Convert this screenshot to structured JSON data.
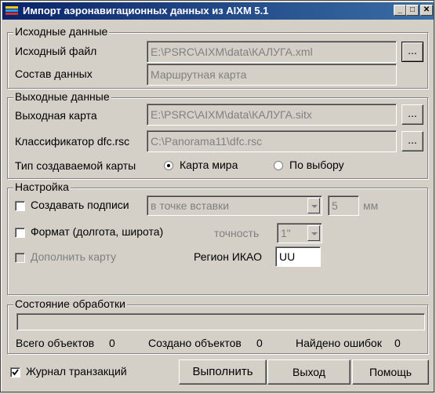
{
  "window": {
    "title": "Импорт аэронавигационных данных из AIXM 5.1"
  },
  "source": {
    "group_label": "Исходные данные",
    "file_label": "Исходный файл",
    "file_value": "E:\\PSRC\\AIXM\\data\\КАЛУГА.xml",
    "browse_label": "...",
    "composition_label": "Состав данных",
    "composition_value": "Маршрутная карта"
  },
  "output": {
    "group_label": "Выходные данные",
    "map_label": "Выходная карта",
    "map_value": "E:\\PSRC\\AIXM\\data\\КАЛУГА.sitx",
    "classifier_label": "Классификатор dfc.rsc",
    "classifier_value": "C:\\Panorama11\\dfc.rsc",
    "browse_label": "...",
    "map_type_label": "Тип создаваемой карты",
    "radio_world": "Карта мира",
    "radio_choice": "По выбору"
  },
  "settings": {
    "group_label": "Настройка",
    "create_labels": "Создавать подписи",
    "labels_position": "в точке вставки",
    "labels_size": "5",
    "labels_unit": "мм",
    "format_label": "Формат (долгота, широта)",
    "precision_label": "точность",
    "precision_value": "1\"",
    "append_map": "Дополнить карту",
    "icao_label": "Регион ИКАО",
    "icao_value": "UU"
  },
  "status": {
    "group_label": "Состояние обработки",
    "progress": 0,
    "total_label": "Всего объектов",
    "total_value": "0",
    "created_label": "Создано объектов",
    "created_value": "0",
    "errors_label": "Найдено ошибок",
    "errors_value": "0"
  },
  "footer": {
    "journal_label": "Журнал транзакций",
    "run_label": "Выполнить",
    "exit_label": "Выход",
    "help_label": "Помощь"
  }
}
